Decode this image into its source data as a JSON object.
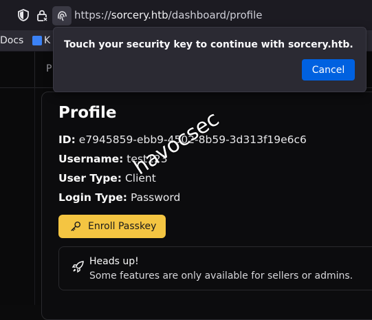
{
  "browser": {
    "url_prefix": "https://",
    "url_host": "sorcery.htb",
    "url_path": "/dashboard/profile",
    "icons": [
      "shield-icon",
      "lock-icon",
      "fingerprint-icon"
    ]
  },
  "bookmarks": {
    "items": [
      {
        "label": "Docs"
      },
      {
        "label": "K"
      }
    ]
  },
  "topnav": {
    "partial_label": "P"
  },
  "popup": {
    "message": "Touch your security key to continue with sorcery.htb.",
    "cancel_label": "Cancel"
  },
  "profile": {
    "title": "Profile",
    "id_label": "ID:",
    "id_value": "e7945859-ebb9-4502-8b59-3d313f19e6c6",
    "username_label": "Username:",
    "username_value": "test123",
    "usertype_label": "User Type:",
    "usertype_value": "Client",
    "logintype_label": "Login Type:",
    "logintype_value": "Password",
    "enroll_label": "Enroll Passkey"
  },
  "alert": {
    "heading": "Heads up!",
    "description": "Some features are only available for sellers or admins."
  },
  "watermark": "havocsec",
  "colors": {
    "accent_yellow": "#f4c542",
    "button_blue": "#0061e0",
    "page_bg": "#0a0a0b"
  }
}
